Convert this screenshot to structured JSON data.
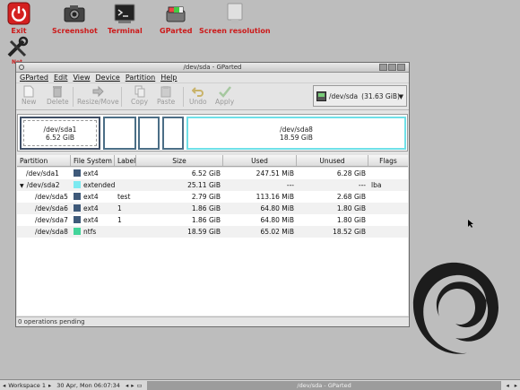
{
  "desktop": {
    "icons": [
      {
        "label": "Exit",
        "icon": "power-icon"
      },
      {
        "label": "Screenshot",
        "icon": "camera-icon"
      },
      {
        "label": "Terminal",
        "icon": "terminal-icon"
      },
      {
        "label": "GParted",
        "icon": "gparted-icon"
      },
      {
        "label": "Screen resolution",
        "icon": "monitor-icon"
      },
      {
        "label": "Net",
        "icon": "network-tools-icon"
      }
    ]
  },
  "window": {
    "title": "/dev/sda - GParted",
    "menu": [
      "GParted",
      "Edit",
      "View",
      "Device",
      "Partition",
      "Help"
    ],
    "toolbar": {
      "new": "New",
      "delete": "Delete",
      "resize_move": "Resize/Move",
      "copy": "Copy",
      "paste": "Paste",
      "undo": "Undo",
      "apply": "Apply"
    },
    "device_selector": {
      "device": "/dev/sda",
      "size": "(31.63 GiB)"
    },
    "disk_graph": {
      "sda1_name": "/dev/sda1",
      "sda1_size": "6.52 GiB",
      "sda8_name": "/dev/sda8",
      "sda8_size": "18.59 GiB"
    },
    "columns": [
      "Partition",
      "File System",
      "Label",
      "Size",
      "Used",
      "Unused",
      "Flags"
    ],
    "rows": [
      {
        "partition": "/dev/sda1",
        "fs": "ext4",
        "label": "",
        "size": "6.52 GiB",
        "used": "247.51 MiB",
        "unused": "6.28 GiB",
        "flags": ""
      },
      {
        "partition": "/dev/sda2",
        "fs": "extended",
        "label": "",
        "size": "25.11 GiB",
        "used": "---",
        "unused": "---",
        "flags": "lba"
      },
      {
        "partition": "/dev/sda5",
        "fs": "ext4",
        "label": "test",
        "size": "2.79 GiB",
        "used": "113.16 MiB",
        "unused": "2.68 GiB",
        "flags": ""
      },
      {
        "partition": "/dev/sda6",
        "fs": "ext4",
        "label": "1",
        "size": "1.86 GiB",
        "used": "64.80 MiB",
        "unused": "1.80 GiB",
        "flags": ""
      },
      {
        "partition": "/dev/sda7",
        "fs": "ext4",
        "label": "1",
        "size": "1.86 GiB",
        "used": "64.80 MiB",
        "unused": "1.80 GiB",
        "flags": ""
      },
      {
        "partition": "/dev/sda8",
        "fs": "ntfs",
        "label": "",
        "size": "18.59 GiB",
        "used": "65.02 MiB",
        "unused": "18.52 GiB",
        "flags": ""
      }
    ],
    "fs_colors": {
      "ext4": "#3f5a7a",
      "extended": "#7be9f0",
      "ntfs": "#43d49a"
    },
    "status": "0 operations pending"
  },
  "taskbar": {
    "workspace": "Workspace 1",
    "clock": "30 Apr, Mon 06:07:34",
    "task": "/dev/sda - GParted"
  }
}
